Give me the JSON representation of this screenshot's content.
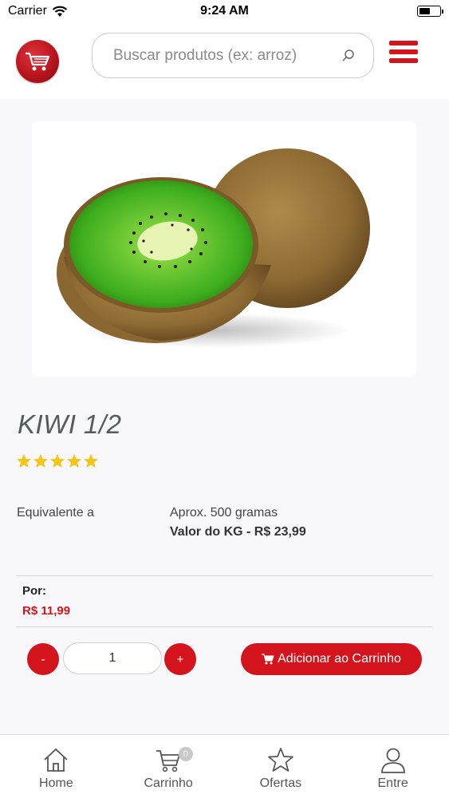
{
  "status_bar": {
    "carrier": "Carrier",
    "time": "9:24 AM",
    "battery_level": 0.55
  },
  "header": {
    "logo_icon": "shopping-cart-logo-icon",
    "search_placeholder": "Buscar produtos (ex: arroz)",
    "search_icon": "search-icon",
    "menu_icon": "hamburger-menu-icon"
  },
  "product": {
    "image_icon": "kiwi-image",
    "title": "KIWI 1/2",
    "rating": 5,
    "equivalent_label": "Equivalente a",
    "equivalent_value": "Aprox. 500 gramas",
    "kg_value": "Valor do KG - R$ 23,99",
    "price_label": "Por:",
    "price": "R$ 11,99"
  },
  "quantity": {
    "minus_label": "-",
    "value": "1",
    "plus_label": "+"
  },
  "add_to_cart_label": "Adicionar ao Carrinho",
  "tabs": [
    {
      "label": "Home",
      "icon": "home-icon"
    },
    {
      "label": "Carrinho",
      "icon": "cart-icon",
      "badge": "0"
    },
    {
      "label": "Ofertas",
      "icon": "star-icon"
    },
    {
      "label": "Entre",
      "icon": "user-icon"
    }
  ],
  "colors": {
    "accent": "#d4141c",
    "star": "#f5c518",
    "background": "#f8f8fa"
  }
}
